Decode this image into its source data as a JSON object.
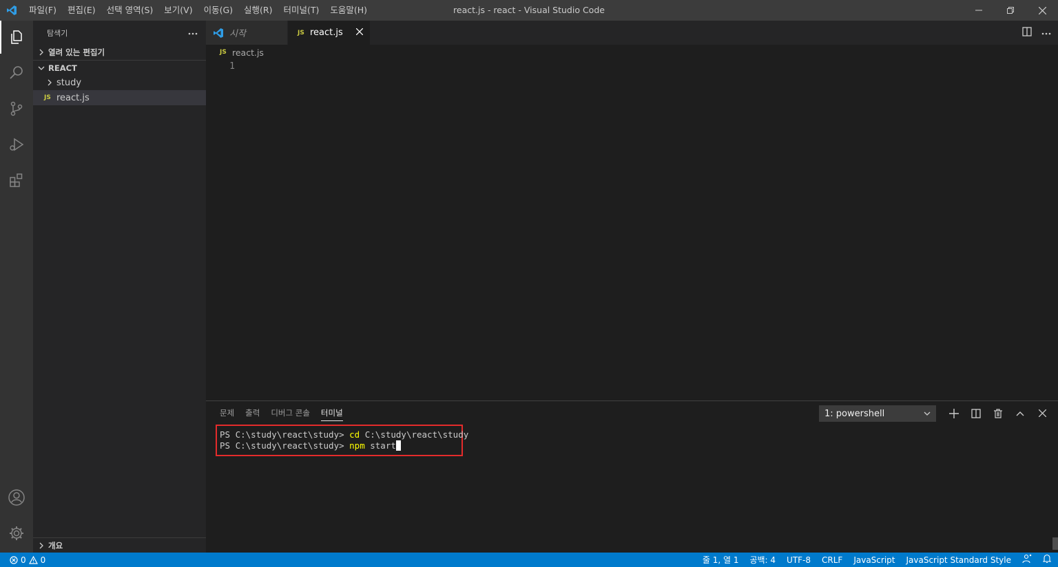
{
  "window": {
    "title": "react.js - react - Visual Studio Code"
  },
  "menu": [
    "파일(F)",
    "편집(E)",
    "선택 영역(S)",
    "보기(V)",
    "이동(G)",
    "실행(R)",
    "터미널(T)",
    "도움말(H)"
  ],
  "sidebar": {
    "header": "탐색기",
    "more_icon": "ellipsis-icon",
    "open_editors": "열려 있는 편집기",
    "folder": "REACT",
    "items": [
      {
        "label": "study",
        "type": "folder"
      },
      {
        "label": "react.js",
        "type": "file",
        "badge": "JS"
      }
    ],
    "outline": "개요"
  },
  "editor": {
    "tabs": [
      {
        "label": "시작",
        "active": false
      },
      {
        "label": "react.js",
        "badge": "JS",
        "active": true
      }
    ],
    "breadcrumb_badge": "JS",
    "breadcrumb": "react.js",
    "line_number": "1"
  },
  "panel": {
    "tabs": [
      "문제",
      "출력",
      "디버그 콘솔",
      "터미널"
    ],
    "active_tab": "터미널",
    "terminal_select": "1: powershell",
    "lines": [
      {
        "prompt": "PS C:\\study\\react\\study> ",
        "cmd": "cd",
        "args": " C:\\study\\react\\study"
      },
      {
        "prompt": "PS C:\\study\\react\\study> ",
        "cmd": "npm",
        "args": " start"
      }
    ]
  },
  "statusbar": {
    "errors": "0",
    "warnings": "0",
    "position": "줄 1, 열 1",
    "spaces": "공백: 4",
    "encoding": "UTF-8",
    "eol": "CRLF",
    "language": "JavaScript",
    "linter": "JavaScript Standard Style"
  },
  "colors": {
    "accent": "#007acc",
    "highlight_box": "#e52b2b",
    "js_badge": "#cbcb41"
  }
}
